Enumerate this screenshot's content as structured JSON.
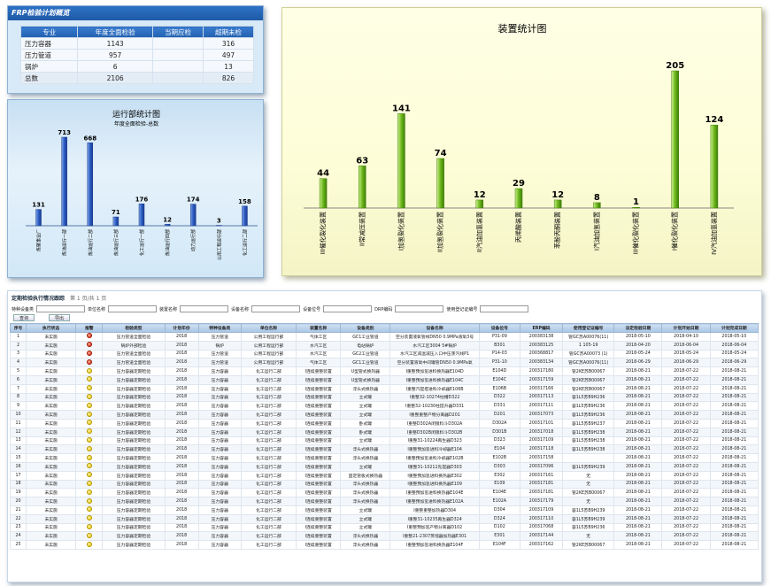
{
  "panel1": {
    "title": "FRP检验计划概览",
    "headers": [
      "专业",
      "年度全面检验",
      "当期应检",
      "超期未检"
    ],
    "rows": [
      [
        "压力容器",
        "1143",
        "",
        "316"
      ],
      [
        "压力管道",
        "957",
        "",
        "497"
      ],
      [
        "锅炉",
        "6",
        "",
        "13"
      ],
      [
        "总数",
        "2106",
        "",
        "826"
      ]
    ]
  },
  "panel2": {
    "title": "运行部统计图",
    "subtitle": "年度全面检验-总数"
  },
  "panel3": {
    "title": "装置统计图"
  },
  "chart_data": [
    {
      "type": "bar",
      "title": "运行部统计图",
      "subtitle": "年度全面检验-总数",
      "categories": [
        "炼聚事业厂",
        "炼油运行一部",
        "炼油运行二部",
        "炼油运行三部",
        "化工运行一部",
        "炼油运行四部",
        "动力运行部",
        "公用工程运行部",
        "化工运行二部"
      ],
      "values": [
        131,
        713,
        668,
        71,
        176,
        12,
        174,
        3,
        158
      ]
    },
    {
      "type": "bar",
      "title": "装置统计图",
      "categories": [
        "III催化裂化装置",
        "II常减压装置",
        "I加氢裂化装置",
        "II加氢裂化装置",
        "II汽油加氢装置",
        "丙烯酸装置",
        "苯酚丙酮装置",
        "I汽油加氢装置",
        "III催化裂化装置",
        "I催化裂化装置",
        "IV汽油加氢装置"
      ],
      "values": [
        44,
        63,
        141,
        74,
        12,
        29,
        12,
        8,
        1,
        205,
        124
      ]
    }
  ],
  "panel4": {
    "title": "定期检验执行情况跟踪",
    "pager": "第 1 页/共 1 页",
    "search": {
      "l1": "特种设备类",
      "l2": "单位名称",
      "l3": "装置名称",
      "l4": "设备名称",
      "l5": "设备位号",
      "l6": "DRP编码",
      "l7": "使用登记证编号"
    },
    "btn_query": "查询",
    "btn_export": "导出",
    "headers": [
      "序号",
      "执行状态",
      "报警",
      "检验类型",
      "计划年份",
      "特种设备类",
      "单位名称",
      "装置名称",
      "设备类别",
      "设备名称",
      "设备位号",
      "ERP编码",
      "使用登记证编号",
      "法定检验日期",
      "计划开始日期",
      "计划完成日期"
    ],
    "rows": [
      [
        "1",
        "未实施",
        "red",
        "压力管道全面检验",
        "2018",
        "压力管道",
        "公用工程运行部",
        "气体工区",
        "GC1工业管道",
        "空分装置液氧管线DN50 0.9MPa液氧3号",
        "P31-09",
        "200383138",
        "管GC苏A00076(11)",
        "2018-05-10",
        "2018-04-10",
        "2018-05-10"
      ],
      [
        "2",
        "未实施",
        "red",
        "锅炉外部检验",
        "2018",
        "锅炉",
        "公用工程运行部",
        "水汽工区",
        "电站锅炉",
        "水汽工区3004 5#锅炉",
        "B301",
        "200383125",
        "1 105-19",
        "2018-04-20",
        "2018-06-04",
        "2018-06-04"
      ],
      [
        "3",
        "未实施",
        "red",
        "压力管道全面检验",
        "2018",
        "压力管道",
        "公用工程运行部",
        "水汽工区",
        "GC2工业管道",
        "水汽工区减温减压入口中压蒸汽线P1",
        "P14-03",
        "200368817",
        "管GC苏A00073 (1)",
        "2018-05-24",
        "2018-05-24",
        "2018-05-24"
      ],
      [
        "4",
        "未实施",
        "red",
        "压力管道全面检验",
        "2018",
        "压力管道",
        "公用工程运行部",
        "气体工区",
        "GC1工业管道",
        "空分装置液氧中间罐管DN50 0.9MPa氧",
        "P31-10",
        "200383134",
        "管GC苏A00076(11)",
        "2018-06-29",
        "2018-06-29",
        "2018-06-29"
      ],
      [
        "5",
        "未实施",
        "yellow",
        "压力容器定期检验",
        "2018",
        "压力容器",
        "化工运行二部",
        "I连续重整装置",
        "U型管式换热器",
        "I重整预加氢进料换热器E104D",
        "E104D",
        "200317180",
        "管2KE苏B00067",
        "2018-08-21",
        "2018-07-22",
        "2018-08-21"
      ],
      [
        "6",
        "未实施",
        "yellow",
        "压力容器定期检验",
        "2018",
        "压力容器",
        "化工运行二部",
        "I连续重整装置",
        "U型管式换热器",
        "I重整预加氢进料换热器E104C",
        "E104C",
        "200317159",
        "管2KE苏B00067",
        "2018-08-21",
        "2018-07-22",
        "2018-08-21"
      ],
      [
        "7",
        "未实施",
        "yellow",
        "压力容器定期检验",
        "2018",
        "压力容器",
        "化工运行二部",
        "I连续重整装置",
        "浮头式换热器",
        "I重整汽提塔进料冷却器E106B",
        "E106B",
        "200317166",
        "管2KE苏B00067",
        "2018-08-21",
        "2018-07-22",
        "2018-08-21"
      ],
      [
        "8",
        "未实施",
        "yellow",
        "压力容器定期检验",
        "2018",
        "压力容器",
        "化工运行二部",
        "I连续重整装置",
        "立式罐",
        "I重整32-10274柱槽D322",
        "D322",
        "200317113",
        "容1L5苏B9H236",
        "2018-08-21",
        "2018-07-22",
        "2018-08-21"
      ],
      [
        "9",
        "未实施",
        "yellow",
        "压力容器定期检验",
        "2018",
        "压力容器",
        "化工运行二部",
        "I连续重整装置",
        "立式罐",
        "I重整32-10230柱提升器D331",
        "D331",
        "200317111",
        "容1L5苏B9H236",
        "2018-08-21",
        "2018-07-22",
        "2018-08-21"
      ],
      [
        "10",
        "未实施",
        "yellow",
        "压力容器定期检验",
        "2018",
        "压力容器",
        "化工运行二部",
        "I连续重整装置",
        "立式罐",
        "I重整重整产物分离器D201",
        "D201",
        "200317073",
        "容1L5苏B9H236",
        "2018-08-21",
        "2018-07-22",
        "2018-08-21"
      ],
      [
        "11",
        "未实施",
        "yellow",
        "压力容器定期检验",
        "2018",
        "压力容器",
        "化工运行二部",
        "I连续重整装置",
        "卧式罐",
        "I重整D302A闭锁料斗D302A",
        "D302A",
        "200317101",
        "容1L5苏B9H237",
        "2018-08-21",
        "2018-07-22",
        "2018-08-21"
      ],
      [
        "12",
        "未实施",
        "yellow",
        "压力容器定期检验",
        "2018",
        "压力容器",
        "化工运行二部",
        "I连续重整装置",
        "卧式罐",
        "I重整D302B闭锁料斗D302B",
        "D301B",
        "200317018",
        "容1L5苏B9H238",
        "2018-08-21",
        "2018-07-22",
        "2018-08-21"
      ],
      [
        "13",
        "未实施",
        "yellow",
        "压力容器定期检验",
        "2018",
        "压力容器",
        "化工运行二部",
        "I连续重整装置",
        "立式罐",
        "I重整31-10224再生器D323",
        "D323",
        "200317109",
        "容1L5苏B9H238",
        "2018-08-21",
        "2018-07-22",
        "2018-08-21"
      ],
      [
        "14",
        "未实施",
        "yellow",
        "压力容器定期检验",
        "2018",
        "压力容器",
        "化工运行二部",
        "I连续重整装置",
        "浮头式换热器",
        "I重整预加氢进料冷却器E104",
        "E104",
        "200317118",
        "容1L5苏B9H238",
        "2018-08-21",
        "2018-07-22",
        "2018-08-21"
      ],
      [
        "15",
        "未实施",
        "yellow",
        "压力容器定期检验",
        "2018",
        "压力容器",
        "化工运行二部",
        "I连续重整装置",
        "浮头式换热器",
        "I重整预加氢进料冷却器E102B",
        "E102B",
        "200317158",
        "",
        "2018-08-21",
        "2018-07-22",
        "2018-08-21"
      ],
      [
        "16",
        "未实施",
        "yellow",
        "压力容器定期检验",
        "2018",
        "压力容器",
        "化工运行二部",
        "I连续重整装置",
        "立式罐",
        "I重整31-10212先提器D303",
        "D303",
        "200317096",
        "容1L5苏B9H239",
        "2018-08-21",
        "2018-07-22",
        "2018-08-21"
      ],
      [
        "17",
        "未实施",
        "yellow",
        "压力容器定期检验",
        "2018",
        "压力容器",
        "化工运行二部",
        "I连续重整装置",
        "固定管板式换热器",
        "I重整预加氢进料换热器E302",
        "E302",
        "200317161",
        "无",
        "2018-08-21",
        "2018-07-22",
        "2018-08-21"
      ],
      [
        "18",
        "未实施",
        "yellow",
        "压力容器定期检验",
        "2018",
        "压力容器",
        "化工运行二部",
        "I连续重整装置",
        "浮头式换热器",
        "I重整预加氢进料换热器E109",
        "E109",
        "200317181",
        "无",
        "2018-08-21",
        "2018-07-22",
        "2018-08-21"
      ],
      [
        "19",
        "未实施",
        "yellow",
        "压力容器定期检验",
        "2018",
        "压力容器",
        "化工运行二部",
        "I连续重整装置",
        "浮头式换热器",
        "I重整预加氢进料换热器E104E",
        "E104E",
        "200317181",
        "管2KE苏B00067",
        "2018-08-21",
        "2018-07-22",
        "2018-08-21"
      ],
      [
        "20",
        "未实施",
        "yellow",
        "压力容器定期检验",
        "2018",
        "压力容器",
        "化工运行二部",
        "I连续重整装置",
        "浮头式换热器",
        "I重整预加氢进料换热器E102A",
        "E102A",
        "200317179",
        "无",
        "2018-08-21",
        "2018-07-22",
        "2018-08-21"
      ],
      [
        "21",
        "未实施",
        "yellow",
        "压力容器定期检验",
        "2018",
        "压力容器",
        "化工运行二部",
        "I连续重整装置",
        "立式罐",
        "I重整重整加热器D304",
        "D304",
        "200317109",
        "容1L5苏B9H239",
        "2018-08-21",
        "2018-07-22",
        "2018-08-21"
      ],
      [
        "22",
        "未实施",
        "yellow",
        "压力容器定期检验",
        "2018",
        "压力容器",
        "化工运行二部",
        "I连续重整装置",
        "立式罐",
        "I重整31-10235再生器D324",
        "D324",
        "200317110",
        "容1L5苏B9H239",
        "2018-08-21",
        "2018-07-22",
        "2018-08-21"
      ],
      [
        "23",
        "未实施",
        "yellow",
        "压力容器定期检验",
        "2018",
        "压力容器",
        "化工运行二部",
        "I连续重整装置",
        "立式罐",
        "I重整预加氢产物分离器D102",
        "D102",
        "200317068",
        "容1L5苏B9H236",
        "2018-08-21",
        "2018-07-22",
        "2018-08-21"
      ],
      [
        "24",
        "未实施",
        "yellow",
        "压力容器定期检验",
        "2018",
        "压力容器",
        "化工运行二部",
        "I连续重整装置",
        "浮头式换热器",
        "I重整21-2307蒸馏器加热器E301",
        "E301",
        "200317144",
        "无",
        "2018-08-21",
        "2018-07-22",
        "2018-08-21"
      ],
      [
        "25",
        "未实施",
        "yellow",
        "压力容器定期检验",
        "2018",
        "压力容器",
        "化工运行二部",
        "I连续重整装置",
        "浮头式换热器",
        "I重整预加氢进料换热器E104F",
        "E104F",
        "200317162",
        "管2KE苏B00067",
        "2018-08-21",
        "2018-07-22",
        "2018-08-21"
      ]
    ]
  }
}
